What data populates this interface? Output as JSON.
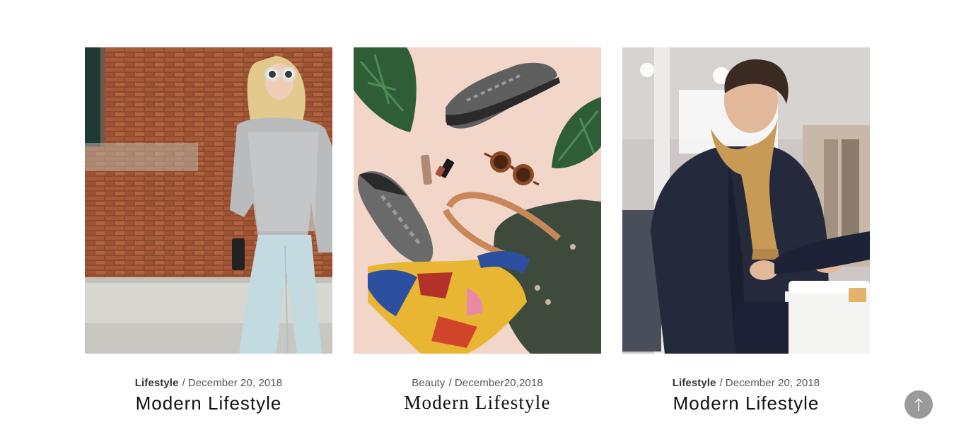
{
  "posts": [
    {
      "category": "Lifestyle",
      "separator": "/",
      "date": "December 20, 2018",
      "title": "Modern Lifestyle",
      "image": "woman-in-sweater-by-brick-wall"
    },
    {
      "category": "Beauty",
      "separator": "/",
      "date": "December20,2018",
      "title": "Modern Lifestyle",
      "image": "flatlay-sneakers-bag-scarf-sunglasses"
    },
    {
      "category": "Lifestyle",
      "separator": "/",
      "date": "December 20, 2018",
      "title": "Modern Lifestyle",
      "image": "man-with-scarf-shopping"
    }
  ],
  "scroll_top": {
    "icon": "arrow-up-icon",
    "color": "#9a9a9a"
  }
}
